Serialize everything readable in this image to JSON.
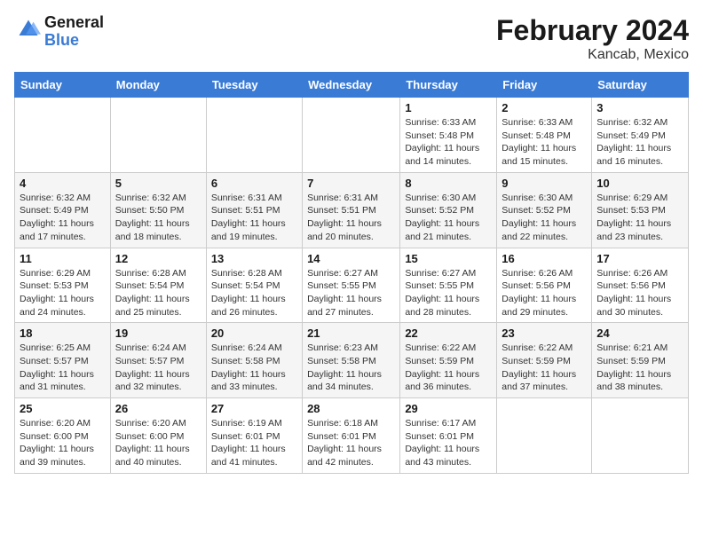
{
  "header": {
    "logo_line1": "General",
    "logo_line2": "Blue",
    "title": "February 2024",
    "subtitle": "Kancab, Mexico"
  },
  "days_of_week": [
    "Sunday",
    "Monday",
    "Tuesday",
    "Wednesday",
    "Thursday",
    "Friday",
    "Saturday"
  ],
  "weeks": [
    [
      {
        "day": "",
        "info": ""
      },
      {
        "day": "",
        "info": ""
      },
      {
        "day": "",
        "info": ""
      },
      {
        "day": "",
        "info": ""
      },
      {
        "day": "1",
        "info": "Sunrise: 6:33 AM\nSunset: 5:48 PM\nDaylight: 11 hours and 14 minutes."
      },
      {
        "day": "2",
        "info": "Sunrise: 6:33 AM\nSunset: 5:48 PM\nDaylight: 11 hours and 15 minutes."
      },
      {
        "day": "3",
        "info": "Sunrise: 6:32 AM\nSunset: 5:49 PM\nDaylight: 11 hours and 16 minutes."
      }
    ],
    [
      {
        "day": "4",
        "info": "Sunrise: 6:32 AM\nSunset: 5:49 PM\nDaylight: 11 hours and 17 minutes."
      },
      {
        "day": "5",
        "info": "Sunrise: 6:32 AM\nSunset: 5:50 PM\nDaylight: 11 hours and 18 minutes."
      },
      {
        "day": "6",
        "info": "Sunrise: 6:31 AM\nSunset: 5:51 PM\nDaylight: 11 hours and 19 minutes."
      },
      {
        "day": "7",
        "info": "Sunrise: 6:31 AM\nSunset: 5:51 PM\nDaylight: 11 hours and 20 minutes."
      },
      {
        "day": "8",
        "info": "Sunrise: 6:30 AM\nSunset: 5:52 PM\nDaylight: 11 hours and 21 minutes."
      },
      {
        "day": "9",
        "info": "Sunrise: 6:30 AM\nSunset: 5:52 PM\nDaylight: 11 hours and 22 minutes."
      },
      {
        "day": "10",
        "info": "Sunrise: 6:29 AM\nSunset: 5:53 PM\nDaylight: 11 hours and 23 minutes."
      }
    ],
    [
      {
        "day": "11",
        "info": "Sunrise: 6:29 AM\nSunset: 5:53 PM\nDaylight: 11 hours and 24 minutes."
      },
      {
        "day": "12",
        "info": "Sunrise: 6:28 AM\nSunset: 5:54 PM\nDaylight: 11 hours and 25 minutes."
      },
      {
        "day": "13",
        "info": "Sunrise: 6:28 AM\nSunset: 5:54 PM\nDaylight: 11 hours and 26 minutes."
      },
      {
        "day": "14",
        "info": "Sunrise: 6:27 AM\nSunset: 5:55 PM\nDaylight: 11 hours and 27 minutes."
      },
      {
        "day": "15",
        "info": "Sunrise: 6:27 AM\nSunset: 5:55 PM\nDaylight: 11 hours and 28 minutes."
      },
      {
        "day": "16",
        "info": "Sunrise: 6:26 AM\nSunset: 5:56 PM\nDaylight: 11 hours and 29 minutes."
      },
      {
        "day": "17",
        "info": "Sunrise: 6:26 AM\nSunset: 5:56 PM\nDaylight: 11 hours and 30 minutes."
      }
    ],
    [
      {
        "day": "18",
        "info": "Sunrise: 6:25 AM\nSunset: 5:57 PM\nDaylight: 11 hours and 31 minutes."
      },
      {
        "day": "19",
        "info": "Sunrise: 6:24 AM\nSunset: 5:57 PM\nDaylight: 11 hours and 32 minutes."
      },
      {
        "day": "20",
        "info": "Sunrise: 6:24 AM\nSunset: 5:58 PM\nDaylight: 11 hours and 33 minutes."
      },
      {
        "day": "21",
        "info": "Sunrise: 6:23 AM\nSunset: 5:58 PM\nDaylight: 11 hours and 34 minutes."
      },
      {
        "day": "22",
        "info": "Sunrise: 6:22 AM\nSunset: 5:59 PM\nDaylight: 11 hours and 36 minutes."
      },
      {
        "day": "23",
        "info": "Sunrise: 6:22 AM\nSunset: 5:59 PM\nDaylight: 11 hours and 37 minutes."
      },
      {
        "day": "24",
        "info": "Sunrise: 6:21 AM\nSunset: 5:59 PM\nDaylight: 11 hours and 38 minutes."
      }
    ],
    [
      {
        "day": "25",
        "info": "Sunrise: 6:20 AM\nSunset: 6:00 PM\nDaylight: 11 hours and 39 minutes."
      },
      {
        "day": "26",
        "info": "Sunrise: 6:20 AM\nSunset: 6:00 PM\nDaylight: 11 hours and 40 minutes."
      },
      {
        "day": "27",
        "info": "Sunrise: 6:19 AM\nSunset: 6:01 PM\nDaylight: 11 hours and 41 minutes."
      },
      {
        "day": "28",
        "info": "Sunrise: 6:18 AM\nSunset: 6:01 PM\nDaylight: 11 hours and 42 minutes."
      },
      {
        "day": "29",
        "info": "Sunrise: 6:17 AM\nSunset: 6:01 PM\nDaylight: 11 hours and 43 minutes."
      },
      {
        "day": "",
        "info": ""
      },
      {
        "day": "",
        "info": ""
      }
    ]
  ]
}
